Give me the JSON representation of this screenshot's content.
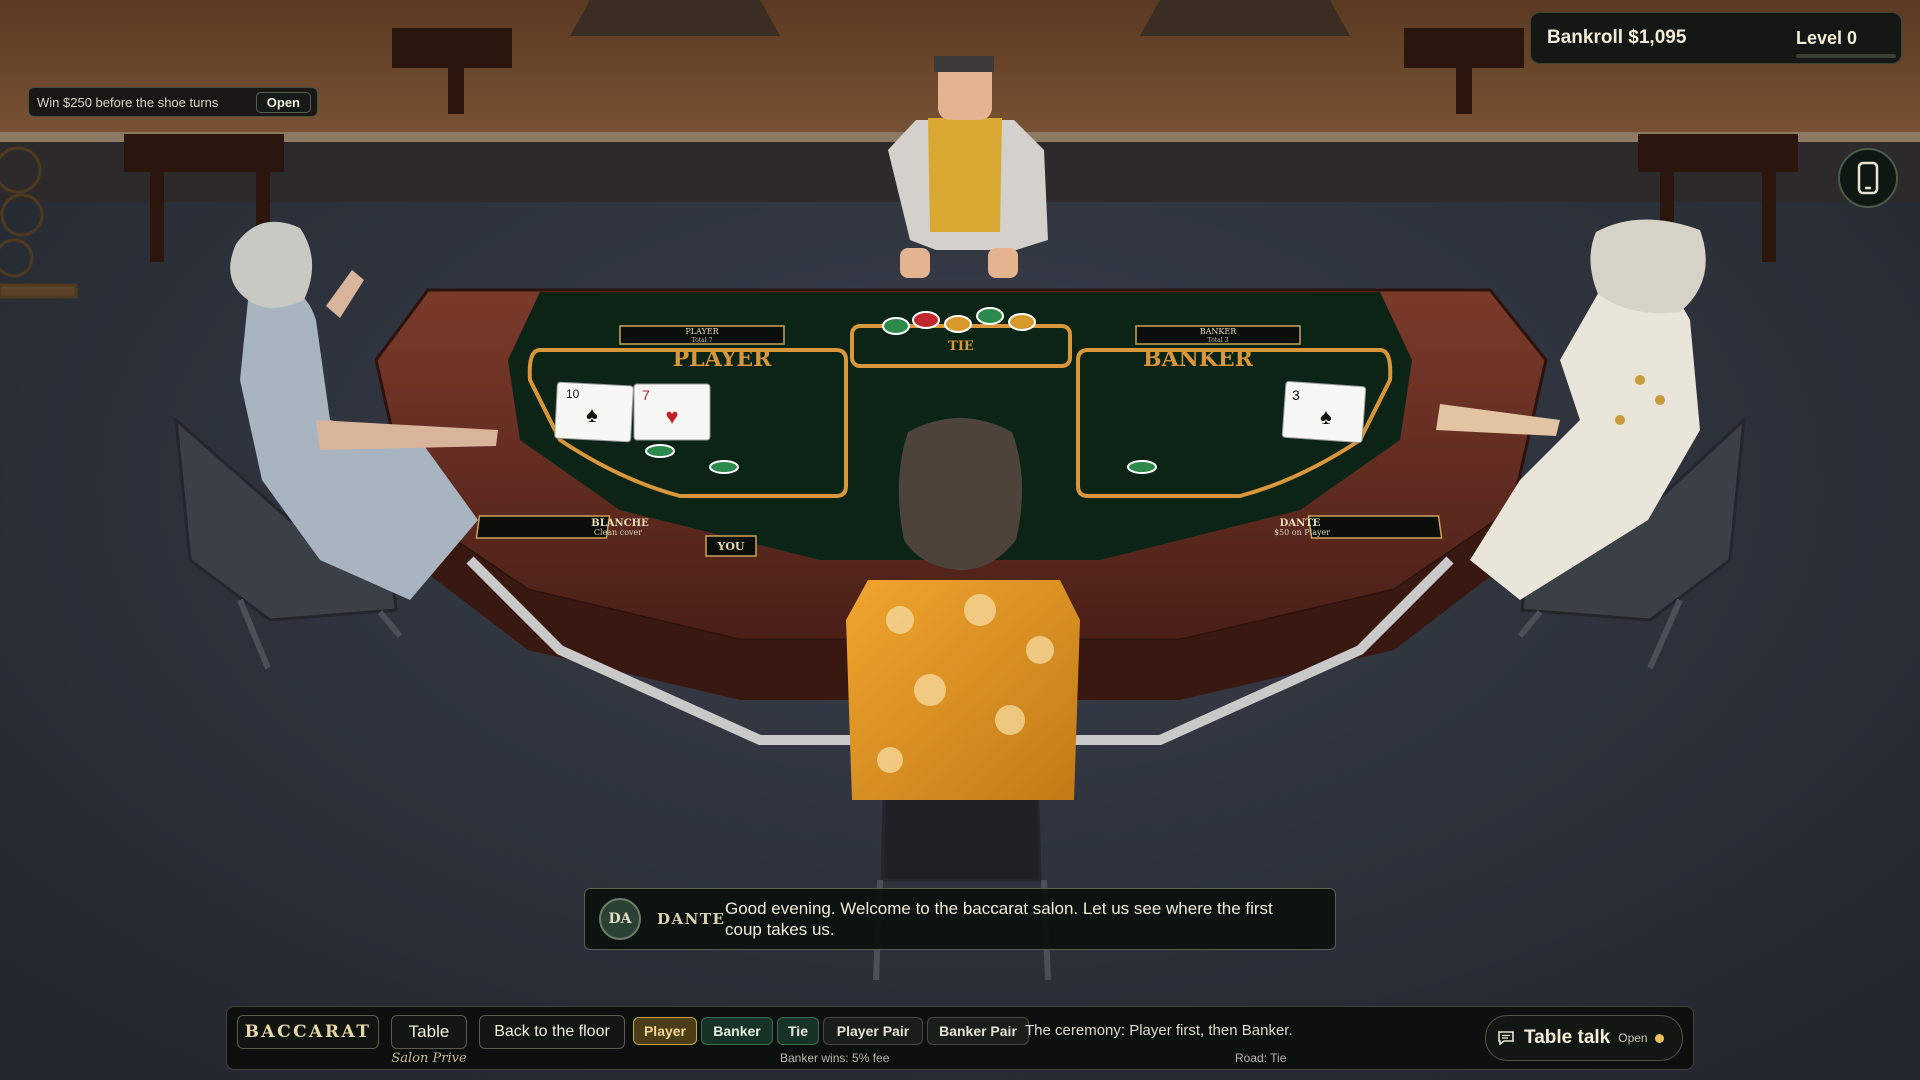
{
  "hud": {
    "bankroll": "Bankroll $1,095",
    "level": "Level 0",
    "level_progress": 0
  },
  "goal": {
    "text": "Win $250 before the shoe turns",
    "button": "Open"
  },
  "phone_icon": "phone-icon",
  "table": {
    "player_area": "PLAYER",
    "banker_area": "BANKER",
    "tie_area": "TIE",
    "player_plate_title": "PLAYER",
    "player_plate_sub": "Total 7",
    "banker_plate_title": "BANKER",
    "banker_plate_sub": "Total 3",
    "you_label": "YOU",
    "seat_left_name": "BLANCHE",
    "seat_left_note": "Clean cover",
    "seat_right_name": "DANTE",
    "seat_right_note": "$50 on Player",
    "player_cards": [
      {
        "rank": "10",
        "suit": "♠",
        "color": "#111111"
      },
      {
        "rank": "7",
        "suit": "♥",
        "color": "#c21f24"
      }
    ],
    "banker_cards": [
      {
        "rank": "3",
        "suit": "♠",
        "color": "#111111"
      }
    ]
  },
  "dialogue": {
    "avatar": "DA",
    "speaker": "DANTE",
    "text": "Good evening. Welcome to the baccarat salon. Let us see where the first coup takes us."
  },
  "bottombar": {
    "brand": "BACCARAT",
    "table_tab": "Table",
    "salon": "Salon Prive",
    "back": "Back to the floor",
    "bets": {
      "player": "Player",
      "banker": "Banker",
      "tie": "Tie",
      "player_pair": "Player Pair",
      "banker_pair": "Banker Pair"
    },
    "ceremony": "The ceremony: Player first, then Banker.",
    "fee": "Banker wins: 5% fee",
    "road": "Road: Tie",
    "talk_label": "Table talk",
    "talk_status": "Open"
  },
  "colors": {
    "felt": "#0c2416",
    "gold": "#d9963a",
    "accent": "#e9c460"
  }
}
